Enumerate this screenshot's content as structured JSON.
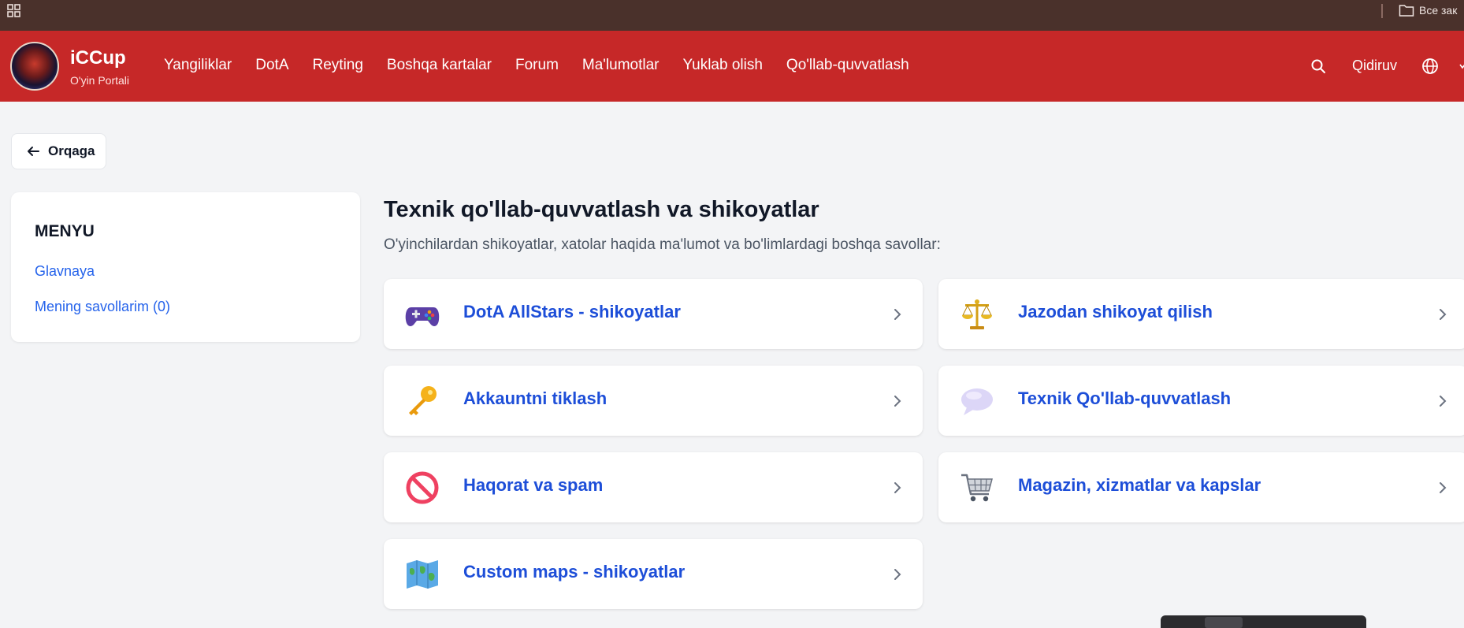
{
  "browser": {
    "bookmark_folder_label": "Все зак"
  },
  "header": {
    "brand_name": "iCCup",
    "brand_subtitle": "O'yin Portali",
    "nav": [
      {
        "label": "Yangiliklar"
      },
      {
        "label": "DotA"
      },
      {
        "label": "Reyting"
      },
      {
        "label": "Boshqa kartalar"
      },
      {
        "label": "Forum"
      },
      {
        "label": "Ma'lumotlar"
      },
      {
        "label": "Yuklab olish"
      },
      {
        "label": "Qo'llab-quvvatlash"
      }
    ],
    "search_label": "Qidiruv",
    "colors": {
      "header_bg": "#c62828",
      "browser_bar_bg": "#4a312b"
    }
  },
  "back_button": {
    "label": "Orqaga"
  },
  "sidebar": {
    "title": "MENYU",
    "items": [
      {
        "label": "Glavnaya"
      },
      {
        "label": "Mening savollarim (0)"
      }
    ]
  },
  "main": {
    "title": "Texnik qo'llab-quvvatlash va shikoyatlar",
    "description": "O'yinchilardan shikoyatlar, xatolar haqida ma'lumot va bo'limlardagi boshqa savollar:",
    "categories": [
      {
        "label": "DotA AllStars - shikoyatlar",
        "icon": "gamepad-icon"
      },
      {
        "label": "Jazodan shikoyat qilish",
        "icon": "scales-icon"
      },
      {
        "label": "Akkauntni tiklash",
        "icon": "key-icon"
      },
      {
        "label": "Texnik Qo'llab-quvvatlash",
        "icon": "speech-bubble-icon"
      },
      {
        "label": "Haqorat va spam",
        "icon": "prohibited-icon"
      },
      {
        "label": "Magazin, xizmatlar va kapslar",
        "icon": "shopping-cart-icon"
      },
      {
        "label": "Custom maps - shikoyatlar",
        "icon": "map-icon"
      }
    ],
    "colors": {
      "link": "#1d4ed8",
      "card_bg": "#ffffff",
      "page_bg": "#f3f4f6"
    }
  }
}
